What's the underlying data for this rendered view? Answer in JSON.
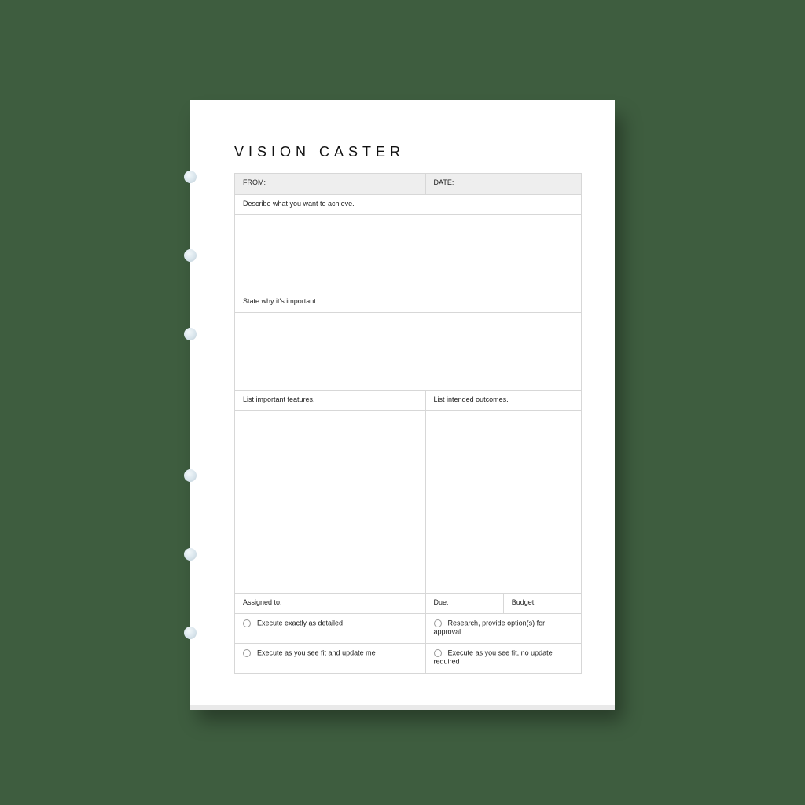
{
  "title": "VISION CASTER",
  "header": {
    "from_label": "FROM:",
    "date_label": "DATE:"
  },
  "prompts": {
    "achieve": "Describe what you want to achieve.",
    "important": "State why it's important.",
    "features": "List important features.",
    "outcomes": "List intended outcomes."
  },
  "footer": {
    "assigned_to": "Assigned to:",
    "due": "Due:",
    "budget": "Budget:"
  },
  "options": {
    "opt1": "Execute exactly as detailed",
    "opt2": "Research, provide option(s) for approval",
    "opt3": "Execute as you see fit and update me",
    "opt4": "Execute as you see fit, no update required"
  }
}
